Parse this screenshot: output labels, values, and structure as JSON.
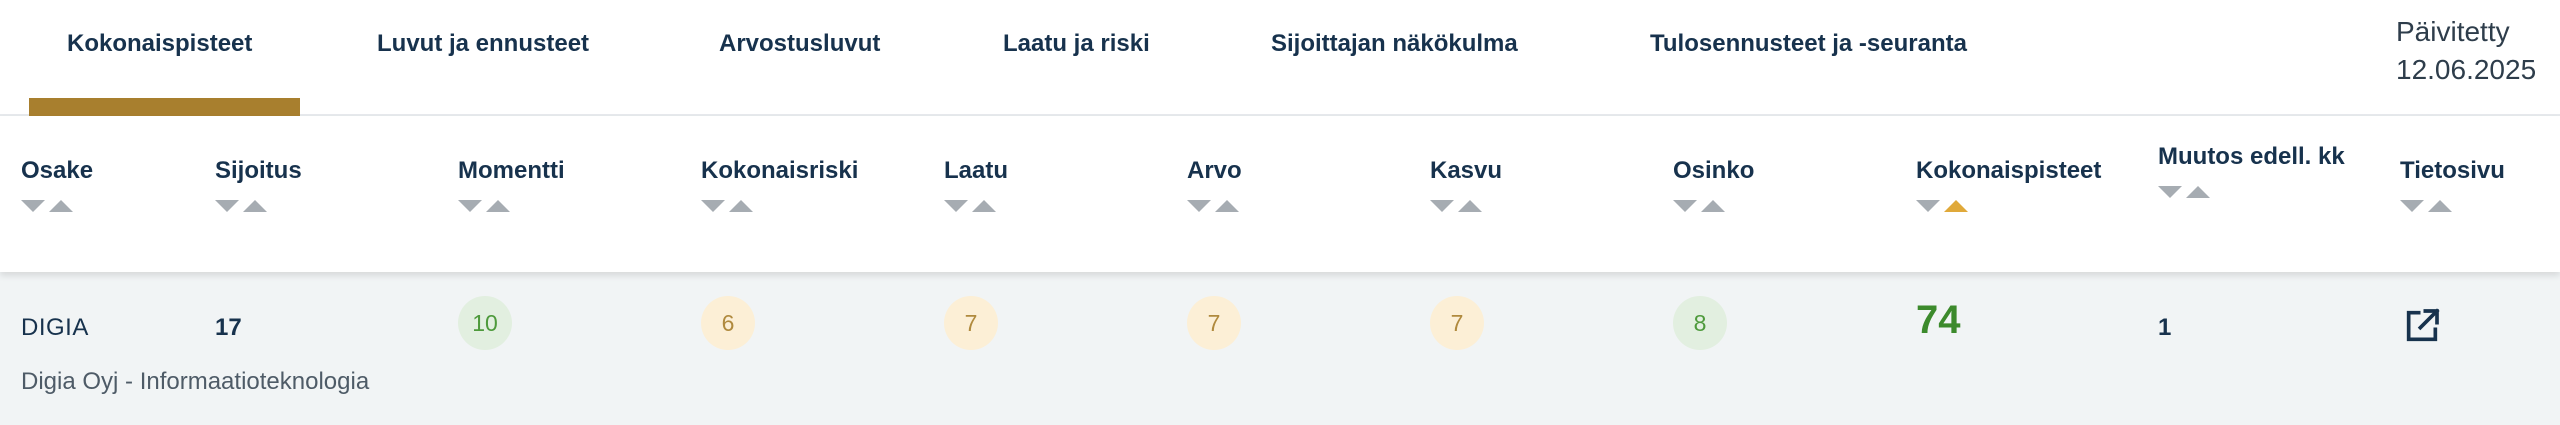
{
  "tabs": [
    {
      "label": "Kokonaispisteet",
      "active": true
    },
    {
      "label": "Luvut ja ennusteet",
      "active": false
    },
    {
      "label": "Arvostusluvut",
      "active": false
    },
    {
      "label": "Laatu ja riski",
      "active": false
    },
    {
      "label": "Sijoittajan näkökulma",
      "active": false
    },
    {
      "label": "Tulosennusteet ja -seuranta",
      "active": false
    }
  ],
  "updated": {
    "label": "Päivitetty",
    "date": "12.06.2025"
  },
  "columns": [
    {
      "label": "Osake",
      "sorted": null
    },
    {
      "label": "Sijoitus",
      "sorted": null
    },
    {
      "label": "Momentti",
      "sorted": null
    },
    {
      "label": "Kokonaisriski",
      "sorted": null
    },
    {
      "label": "Laatu",
      "sorted": null
    },
    {
      "label": "Arvo",
      "sorted": null
    },
    {
      "label": "Kasvu",
      "sorted": null
    },
    {
      "label": "Osinko",
      "sorted": null
    },
    {
      "label": "Kokonaispisteet",
      "sorted": "asc"
    },
    {
      "label": "Muutos edell. kk",
      "sorted": null
    },
    {
      "label": "Tietosivu",
      "sorted": null
    }
  ],
  "row": {
    "ticker": "DIGIA",
    "company": "Digia Oyj - Informaatioteknologia",
    "rank": "17",
    "momentti": "10",
    "kokonaisriski": "6",
    "laatu": "7",
    "arvo": "7",
    "kasvu": "7",
    "osinko": "8",
    "kokonaispisteet": "74",
    "muutos": "1",
    "tietosivu_icon": "external-link-icon"
  },
  "colors": {
    "accent": "#a87f2e",
    "sort_active": "#e0a93a",
    "score_good": "#4e9a3c",
    "score_neutral": "#b08a3e",
    "total_score": "#3c8a2c",
    "row_bg": "#f1f4f5"
  }
}
